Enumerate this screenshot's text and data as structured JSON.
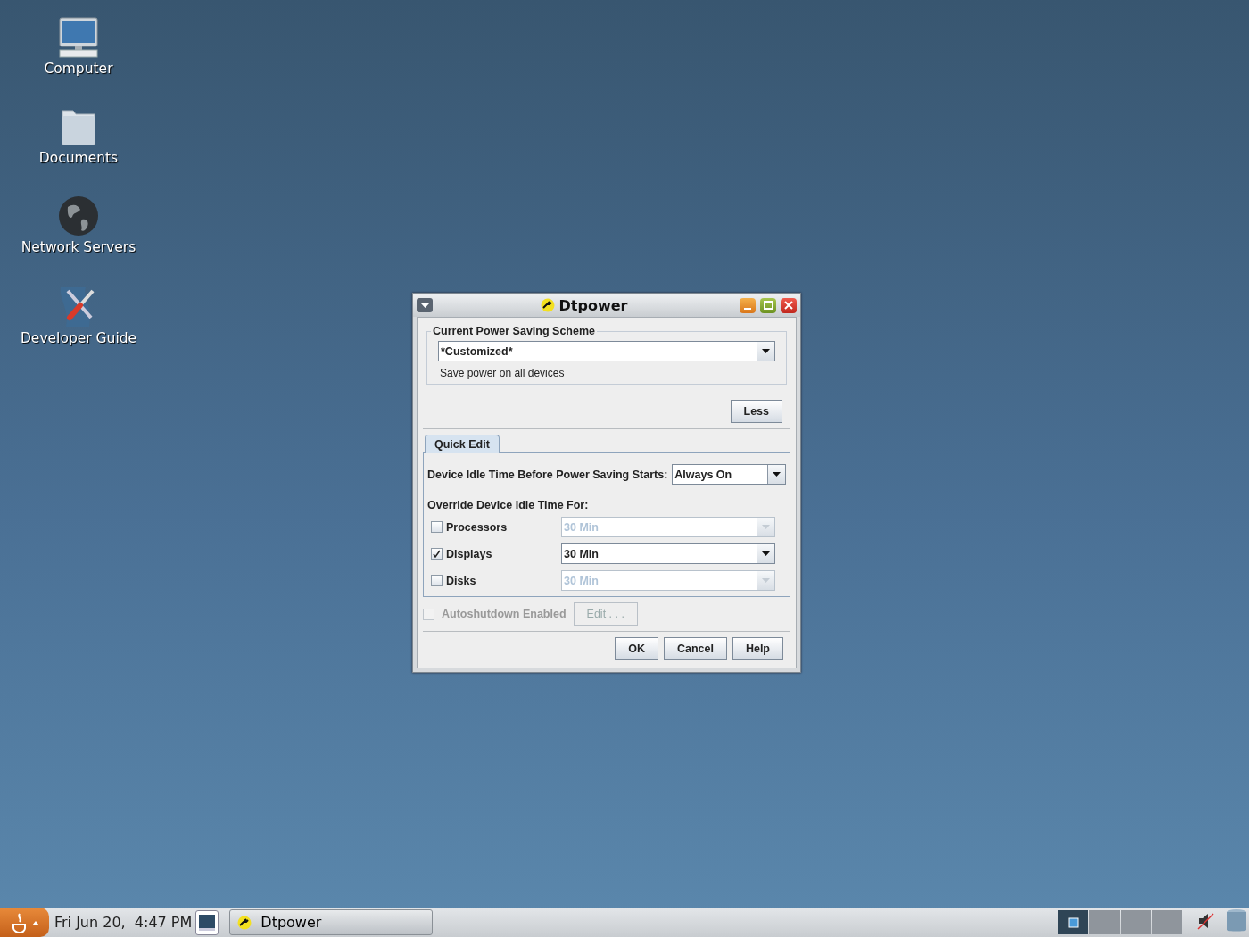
{
  "desktop_icons": [
    {
      "label": "Computer",
      "kind": "computer"
    },
    {
      "label": "Documents",
      "kind": "folder"
    },
    {
      "label": "Network Servers",
      "kind": "globe"
    },
    {
      "label": "Developer Guide",
      "kind": "tools"
    }
  ],
  "window": {
    "title": "Dtpower",
    "scheme": {
      "legend": "Current Power Saving Scheme",
      "value": "*Customized*",
      "description": "Save power on all devices"
    },
    "less_button": "Less",
    "tabs": [
      {
        "label": "Quick Edit",
        "selected": true
      }
    ],
    "idle": {
      "label": "Device Idle Time Before Power Saving Starts:",
      "value": "Always On"
    },
    "override_heading": "Override Device Idle Time For:",
    "overrides": [
      {
        "label": "Processors",
        "checked": false,
        "value": "30 Min"
      },
      {
        "label": "Displays",
        "checked": true,
        "value": "30 Min"
      },
      {
        "label": "Disks",
        "checked": false,
        "value": "30 Min"
      }
    ],
    "autoshutdown": {
      "label": "Autoshutdown Enabled",
      "checked": false,
      "disabled": true
    },
    "edit_button": {
      "label": "Edit . . .",
      "disabled": true
    },
    "buttons": [
      "OK",
      "Cancel",
      "Help"
    ]
  },
  "taskbar": {
    "clock": "Fri Jun 20,  4:47 PM",
    "tasks": [
      {
        "label": "Dtpower",
        "selected": false
      }
    ],
    "workspaces": [
      {
        "selected": true
      },
      {
        "selected": false
      },
      {
        "selected": false
      },
      {
        "selected": false
      }
    ]
  }
}
